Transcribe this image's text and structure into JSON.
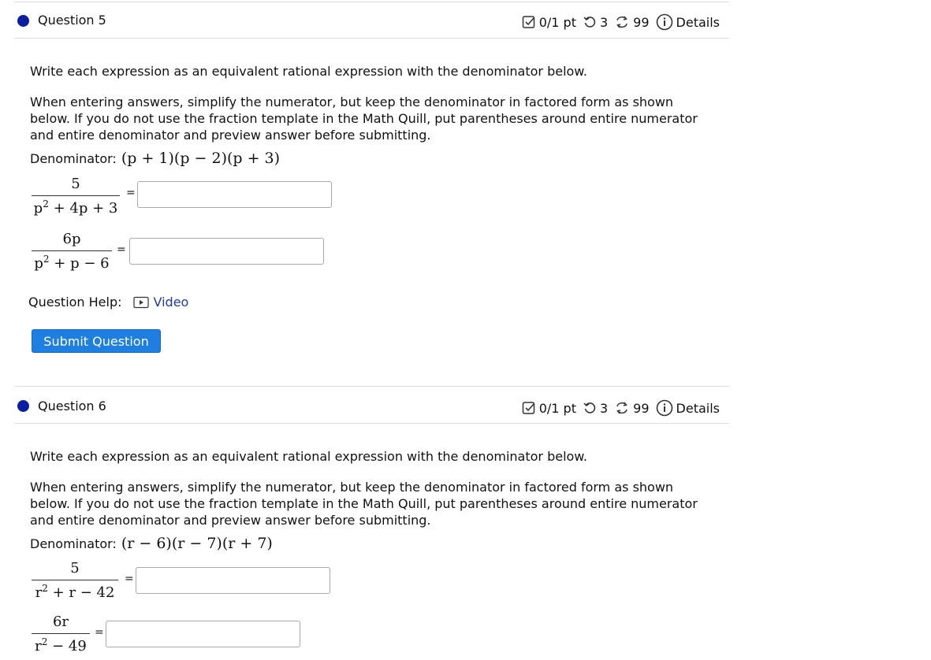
{
  "colors": {
    "dot": "#0b1ea0",
    "accent": "#1e7fe0",
    "link": "#1f3b9c"
  },
  "question_help_label": "Question Help:",
  "video_label": "Video",
  "submit_label": "Submit Question",
  "questions": [
    {
      "title": "Question 5",
      "score": "0/1 pt",
      "retries": "3",
      "attempts": "99",
      "details": "Details",
      "prompt": "Write each expression as an equivalent rational expression with the denominator below.",
      "instructions": "When entering answers, simplify the numerator, but keep the denominator in factored form as shown below. If you do not use the fraction template in the Math Quill, put parentheses around entire numerator and entire denominator and preview answer before submitting.",
      "denominator_label": "Denominator:",
      "denominator": "(p + 1)(p − 2)(p + 3)",
      "parts": [
        {
          "numerator": "5",
          "den_a": "p",
          "den_exp": "2",
          "den_b": " + 4p + 3",
          "equals": "=",
          "value": ""
        },
        {
          "numerator": "6p",
          "den_a": "p",
          "den_exp": "2",
          "den_b": " + p − 6",
          "equals": "=",
          "value": ""
        }
      ]
    },
    {
      "title": "Question 6",
      "score": "0/1 pt",
      "retries": "3",
      "attempts": "99",
      "details": "Details",
      "prompt": "Write each expression as an equivalent rational expression with the denominator below.",
      "instructions": "When entering answers, simplify the numerator, but keep the denominator in factored form as shown below. If you do not use the fraction template in the Math Quill, put parentheses around entire numerator and entire denominator and preview answer before submitting.",
      "denominator_label": "Denominator:",
      "denominator": "(r − 6)(r − 7)(r + 7)",
      "parts": [
        {
          "numerator": "5",
          "den_a": "r",
          "den_exp": "2",
          "den_b": " + r − 42",
          "equals": "=",
          "value": ""
        },
        {
          "numerator": "6r",
          "den_a": "r",
          "den_exp": "2",
          "den_b": " − 49",
          "equals": "=",
          "value": ""
        }
      ]
    }
  ]
}
